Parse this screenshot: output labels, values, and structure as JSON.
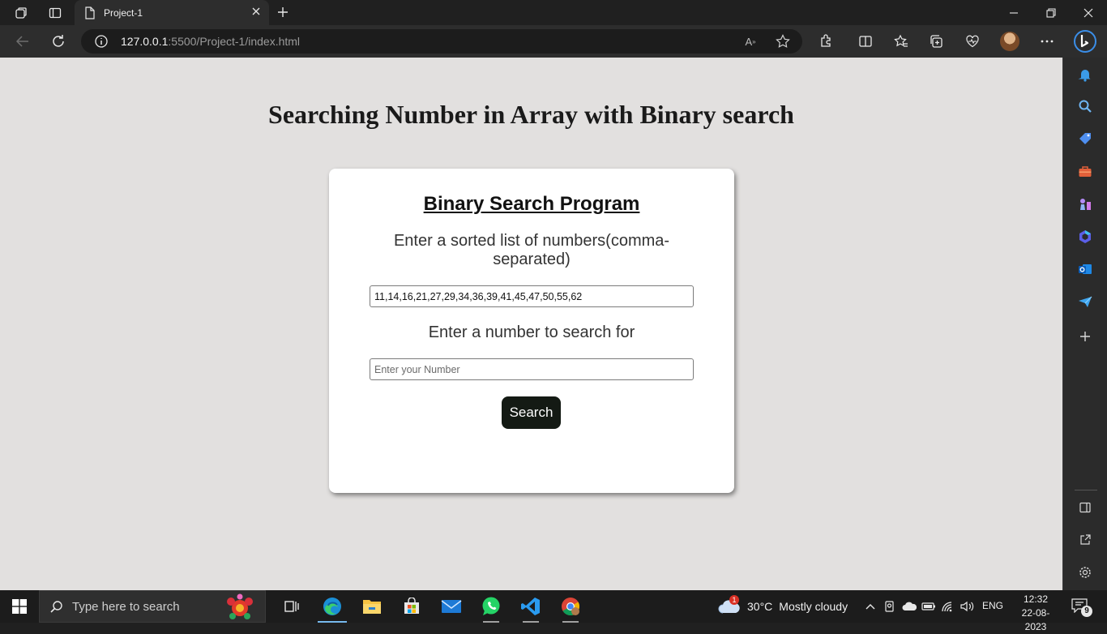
{
  "browser": {
    "tab_title": "Project-1",
    "url_host": "127.0.0.1",
    "url_rest": ":5500/Project-1/index.html"
  },
  "page": {
    "heading": "Searching Number in Array with Binary search",
    "card_title": "Binary Search Program",
    "list_label": "Enter a sorted list of numbers(comma-separated)",
    "list_value": "11,14,16,21,27,29,34,36,39,41,45,47,50,55,62",
    "number_label": "Enter a number to search for",
    "number_placeholder": "Enter your Number",
    "number_value": "",
    "search_button": "Search"
  },
  "taskbar": {
    "search_placeholder": "Type here to search",
    "weather_badge": "1",
    "temperature": "30°C",
    "weather_condition": "Mostly cloudy",
    "language": "ENG",
    "time": "12:32",
    "date": "22-08-2023",
    "notification_count": "9"
  },
  "colors": {
    "page_background": "#e2e0df",
    "card_background": "#ffffff",
    "button_background": "#141a14",
    "taskbar_background": "#1c1c1c",
    "browser_chrome": "#2d2d2d"
  }
}
